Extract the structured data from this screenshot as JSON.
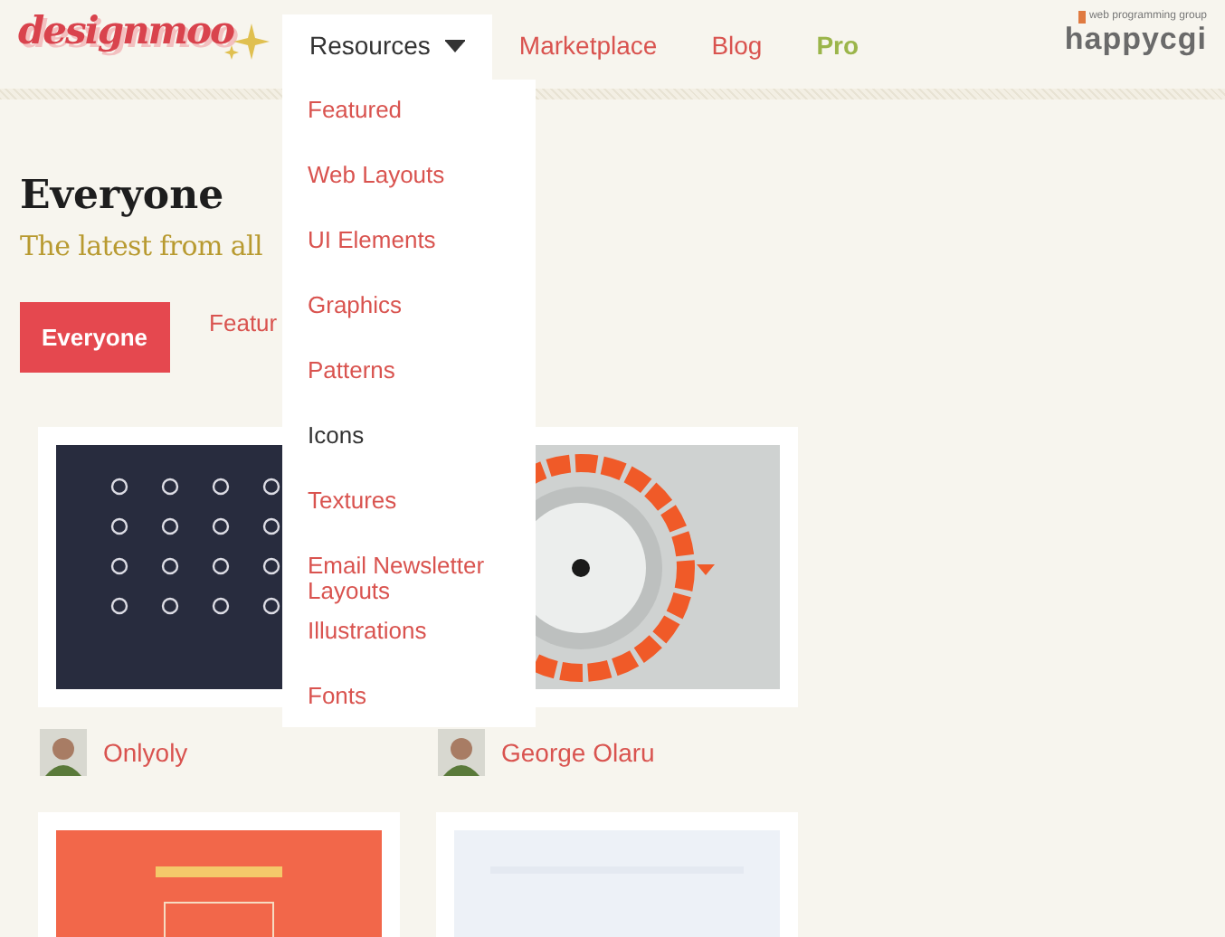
{
  "header": {
    "logo": "designmoo",
    "nav": [
      {
        "label": "Resources",
        "selected": true,
        "kind": "dropdown"
      },
      {
        "label": "Marketplace",
        "selected": false,
        "kind": "link"
      },
      {
        "label": "Blog",
        "selected": false,
        "kind": "link"
      },
      {
        "label": "Pro",
        "selected": false,
        "kind": "pro"
      }
    ],
    "partner_logo": {
      "tagline": "web programming group",
      "name": "happycgi"
    }
  },
  "dropdown": {
    "items": [
      {
        "label": "Featured",
        "selected": false
      },
      {
        "label": "Web Layouts",
        "selected": false
      },
      {
        "label": "UI Elements",
        "selected": false
      },
      {
        "label": "Graphics",
        "selected": false
      },
      {
        "label": "Patterns",
        "selected": false
      },
      {
        "label": "Icons",
        "selected": true
      },
      {
        "label": "Textures",
        "selected": false
      },
      {
        "label": "Email Newsletter Layouts",
        "selected": false
      },
      {
        "label": "Illustrations",
        "selected": false
      },
      {
        "label": "Fonts",
        "selected": false
      }
    ]
  },
  "page": {
    "title": "Everyone",
    "subtitle": "The latest from all"
  },
  "filters": [
    {
      "label": "Everyone",
      "selected": true
    },
    {
      "label": "Featur",
      "selected": false
    }
  ],
  "cards": [
    {
      "kind": "picture",
      "author": "Onlyoly"
    },
    {
      "kind": "picture",
      "author": "George Olaru"
    },
    {
      "kind": "picture"
    },
    {
      "kind": "picture"
    }
  ]
}
